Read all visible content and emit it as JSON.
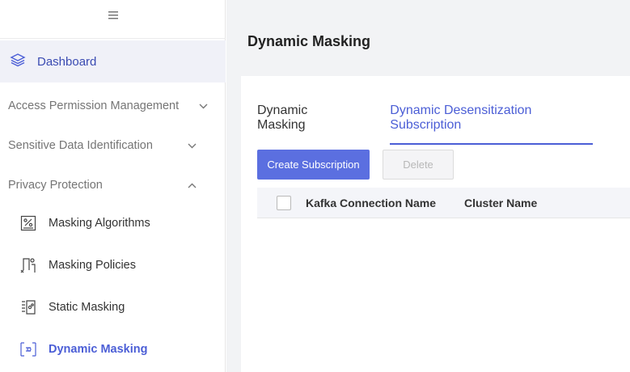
{
  "sidebar": {
    "toggle_icon": "hamburger-icon",
    "dashboard_label": "Dashboard",
    "groups": [
      {
        "label": "Access Permission Management",
        "state": "collapsed"
      },
      {
        "label": "Sensitive Data Identification",
        "state": "collapsed"
      },
      {
        "label": "Privacy Protection",
        "state": "expanded"
      }
    ],
    "items": [
      {
        "label": "Masking Algorithms",
        "icon": "percent-icon"
      },
      {
        "label": "Masking Policies",
        "icon": "policy-icon"
      },
      {
        "label": "Static Masking",
        "icon": "static-masking-icon"
      },
      {
        "label": "Dynamic Masking",
        "icon": "dynamic-masking-icon",
        "active": true
      }
    ]
  },
  "main": {
    "title": "Dynamic Masking",
    "tabs": [
      {
        "label": "Dynamic Masking",
        "active": false
      },
      {
        "label": "Dynamic Desensitization Subscription",
        "active": true
      }
    ],
    "buttons": {
      "create": "Create Subscription",
      "delete": "Delete"
    },
    "table": {
      "columns": [
        "Kafka Connection Name",
        "Cluster Name"
      ],
      "rows": []
    }
  },
  "colors": {
    "accent": "#4b5ed6",
    "primary_button": "#5b6fe0",
    "active_nav_bg": "#f0f1f8",
    "content_bg": "#f2f3f5"
  }
}
